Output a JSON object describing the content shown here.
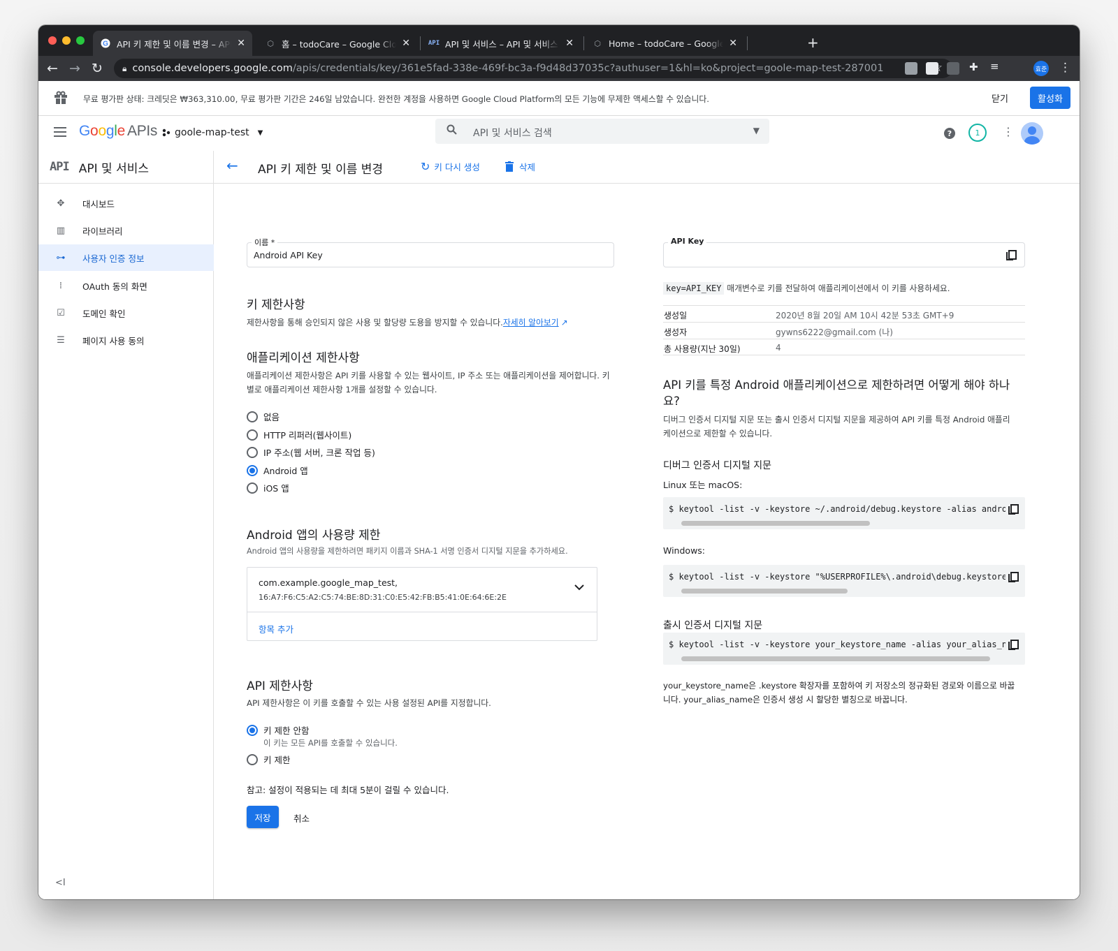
{
  "browser": {
    "tabs": [
      {
        "title": "API 키 제한 및 이름 변경 – API 및 서비스",
        "favicon": "google-g-icon",
        "active": true
      },
      {
        "title": "홈 – todoCare – Google Cloud Platform",
        "favicon": "cloud-hexagon-icon",
        "active": false
      },
      {
        "title": "API 및 서비스 – API 및 서비스 – google",
        "favicon": "api-icon",
        "active": false
      },
      {
        "title": "Home – todoCare – Google Cloud Platform",
        "favicon": "cloud-hexagon-icon",
        "active": false
      }
    ],
    "url_host": "console.developers.google.com",
    "url_path": "/apis/credentials/key/361e5fad-338e-469f-bc3a-f9d48d37035c?authuser=1&hl=ko&project=goole-map-test-287001",
    "profile_label": "효준"
  },
  "banner": {
    "text": "무료 평가판 상태: 크레딧은 ₩363,310.00, 무료 평가판 기간은 246일 남았습니다. 완전한 계정을 사용하면 Google Cloud Platform의 모든 기능에 무제한 액세스할 수 있습니다.",
    "close_label": "닫기",
    "activate_label": "활성화"
  },
  "appbar": {
    "logo_google": "Google",
    "logo_apis": "APIs",
    "project": "goole-map-test",
    "search_placeholder": "API 및 서비스 검색",
    "notification_count": "1"
  },
  "sidebar": {
    "api_mark": "API",
    "title": "API 및 서비스",
    "items": [
      {
        "label": "대시보드",
        "icon": "dashboard-icon",
        "selected": false
      },
      {
        "label": "라이브러리",
        "icon": "library-icon",
        "selected": false
      },
      {
        "label": "사용자 인증 정보",
        "icon": "key-icon",
        "selected": true
      },
      {
        "label": "OAuth 동의 화면",
        "icon": "oauth-icon",
        "selected": false
      },
      {
        "label": "도메인 확인",
        "icon": "domain-check-icon",
        "selected": false
      },
      {
        "label": "페이지 사용 동의",
        "icon": "page-consent-icon",
        "selected": false
      }
    ],
    "collapse_label": "<I"
  },
  "page": {
    "title": "API 키 제한 및 이름 변경",
    "regen_label": "키 다시 생성",
    "delete_label": "삭제",
    "name_field_label": "이름 *",
    "name_field_value": "Android API Key",
    "key_restrictions_title": "키 제한사항",
    "key_restrictions_desc": "제한사항을 통해 승인되지 않은 사용 및 할당량 도용을 방지할 수 있습니다.",
    "learn_more": "자세히 알아보기",
    "app_restrictions_title": "애플리케이션 제한사항",
    "app_restrictions_desc_1": "애플리케이션 제한사항은 API 키를 사용할 수 있는 웹사이트, IP 주소 또는 애플리케이션을 제어합니다. 키",
    "app_restrictions_desc_2": "별로 애플리케이션 제한사항 1개를 설정할 수 있습니다.",
    "app_options": [
      {
        "label": "없음",
        "checked": false
      },
      {
        "label": "HTTP 리퍼러(웹사이트)",
        "checked": false
      },
      {
        "label": "IP 주소(웹 서버, 크론 작업 등)",
        "checked": false
      },
      {
        "label": "Android 앱",
        "checked": true
      },
      {
        "label": "iOS 앱",
        "checked": false
      }
    ],
    "android_title": "Android 앱의 사용량 제한",
    "android_desc": "Android 앱의 사용량을 제한하려면 패키지 이름과 SHA-1 서명 인증서 디지털 지문을 추가하세요.",
    "package_name": "com.example.google_map_test,",
    "package_sha": "16:A7:F6:C5:A2:C5:74:BE:8D:31:C0:E5:42:FB:B5:41:0E:64:6E:2E",
    "add_item": "항목 추가",
    "api_restrictions_title": "API 제한사항",
    "api_restrictions_desc": "API 제한사항은 이 키를 호출할 수 있는 사용 설정된 API를 지정합니다.",
    "api_options": [
      {
        "label": "키 제한 안함",
        "sub": "이 키는 모든 API를 호출할 수 있습니다.",
        "checked": true
      },
      {
        "label": "키 제한",
        "sub": "",
        "checked": false
      }
    ],
    "note": "참고: 설정이 적용되는 데 최대 5분이 걸릴 수 있습니다.",
    "save_label": "저장",
    "cancel_label": "취소"
  },
  "right": {
    "api_key_label": "API Key",
    "hint_code": "key=API_KEY",
    "hint_text": " 매개변수로 키를 전달하여 애플리케이션에서 이 키를 사용하세요.",
    "info": [
      {
        "k": "생성일",
        "v": "2020년 8월 20일 AM 10시 42분 53초 GMT+9"
      },
      {
        "k": "생성자",
        "v": "gywns6222@gmail.com (나)"
      },
      {
        "k": "총 사용량(지난 30일)",
        "v": "4"
      }
    ],
    "howto_title_1": "API 키를 특정 Android 애플리케이션으로 제한하려면 어떻게 해야 하나",
    "howto_title_2": "요?",
    "howto_desc_1": "디버그 인증서 디지털 지문 또는 출시 인증서 디지털 지문을 제공하여 API 키를 특정 Android 애플리",
    "howto_desc_2": "케이션으로 제한할 수 있습니다.",
    "debug_title": "디버그 인증서 디지털 지문",
    "linux_label": "Linux 또는 macOS:",
    "linux_cmd": "$ keytool -list -v -keystore ~/.android/debug.keystore -alias androiddebugkey -storepass android -keypass android",
    "windows_label": "Windows:",
    "windows_cmd": "$ keytool -list -v -keystore \"%USERPROFILE%\\.android\\debug.keystore\" -alias androiddebugkey -storepass android -keypass android",
    "release_title": "출시 인증서 디지털 지문",
    "release_cmd": "$ keytool -list -v -keystore your_keystore_name -alias your_alias_name",
    "footer_1": "your_keystore_name은 .keystore 확장자를 포함하여 키 저장소의 정규화된 경로와 이름으로 바꿉",
    "footer_2": "니다. your_alias_name은 인증서 생성 시 할당한 별칭으로 바꿉니다."
  },
  "colors": {
    "accent": "#1a73e8",
    "selected_bg": "#e8f0fe",
    "chrome_dark": "#202124",
    "chrome_toolbar": "#35363a"
  }
}
